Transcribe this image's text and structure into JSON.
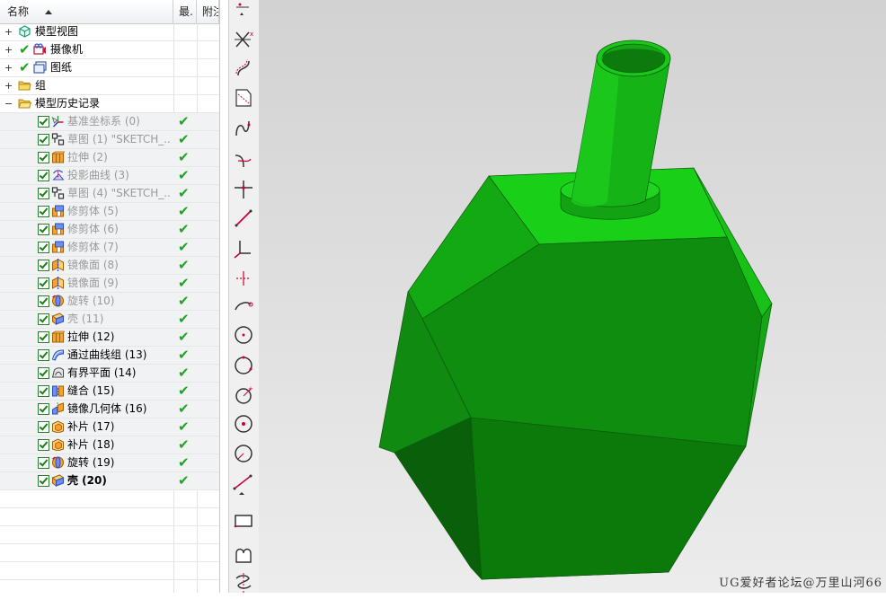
{
  "navigator": {
    "columns": {
      "name": "名称",
      "latest": "最.",
      "attached": "附注"
    },
    "top_nodes": [
      {
        "label": "模型视图",
        "expander": "+",
        "checked": false
      },
      {
        "label": "摄像机",
        "expander": "+",
        "checked": true
      },
      {
        "label": "图纸",
        "expander": "+",
        "checked": true
      },
      {
        "label": "组",
        "expander": "+",
        "checked": false
      },
      {
        "label": "模型历史记录",
        "expander": "−",
        "checked": false
      }
    ],
    "features": [
      {
        "label": "基准坐标系 (0)",
        "icon": "datum-csys-icon",
        "style": "dim"
      },
      {
        "label": "草图 (1) \"SKETCH_...",
        "icon": "sketch-icon",
        "style": "dim"
      },
      {
        "label": "拉伸 (2)",
        "icon": "extrude-icon",
        "style": "dim"
      },
      {
        "label": "投影曲线 (3)",
        "icon": "project-curve-icon",
        "style": "dim"
      },
      {
        "label": "草图 (4) \"SKETCH_...",
        "icon": "sketch-icon",
        "style": "dim"
      },
      {
        "label": "修剪体 (5)",
        "icon": "trim-body-icon",
        "style": "dim"
      },
      {
        "label": "修剪体 (6)",
        "icon": "trim-body-icon",
        "style": "dim"
      },
      {
        "label": "修剪体 (7)",
        "icon": "trim-body-icon",
        "style": "dim"
      },
      {
        "label": "镜像面 (8)",
        "icon": "mirror-face-icon",
        "style": "dim"
      },
      {
        "label": "镜像面 (9)",
        "icon": "mirror-face-icon",
        "style": "dim"
      },
      {
        "label": "旋转 (10)",
        "icon": "revolve-icon",
        "style": "dim"
      },
      {
        "label": "壳 (11)",
        "icon": "shell-icon",
        "style": "dim"
      },
      {
        "label": "拉伸 (12)",
        "icon": "extrude-icon",
        "style": "normal"
      },
      {
        "label": "通过曲线组 (13)",
        "icon": "through-curves-icon",
        "style": "normal"
      },
      {
        "label": "有界平面 (14)",
        "icon": "bounded-plane-icon",
        "style": "normal"
      },
      {
        "label": "缝合 (15)",
        "icon": "sew-icon",
        "style": "normal"
      },
      {
        "label": "镜像几何体 (16)",
        "icon": "mirror-geometry-icon",
        "style": "normal"
      },
      {
        "label": "补片 (17)",
        "icon": "patch-icon",
        "style": "normal"
      },
      {
        "label": "补片 (18)",
        "icon": "patch-icon",
        "style": "normal"
      },
      {
        "label": "旋转 (19)",
        "icon": "revolve-icon",
        "style": "normal"
      },
      {
        "label": "壳 (20)",
        "icon": "shell-icon",
        "style": "bold"
      }
    ]
  },
  "toolbar": {
    "tools": [
      "curve-network-icon",
      "trim-curve-icon",
      "offset-curve-icon",
      "section-icon",
      "bridge-curve-icon",
      "fillet-curve-icon",
      "intersect-icon",
      "line-icon",
      "axis-icon",
      "point-icon",
      "arc-icon",
      "circle-icon",
      "circle-center-icon",
      "circle-3pt-icon",
      "circle-tangent-icon",
      "circle-point-icon",
      "polyline-icon",
      "rectangle-icon",
      "shape-icon",
      "helix-icon"
    ]
  },
  "viewport": {
    "watermark": "UG爱好者论坛@万里山河66",
    "model_color": "#14b814"
  }
}
